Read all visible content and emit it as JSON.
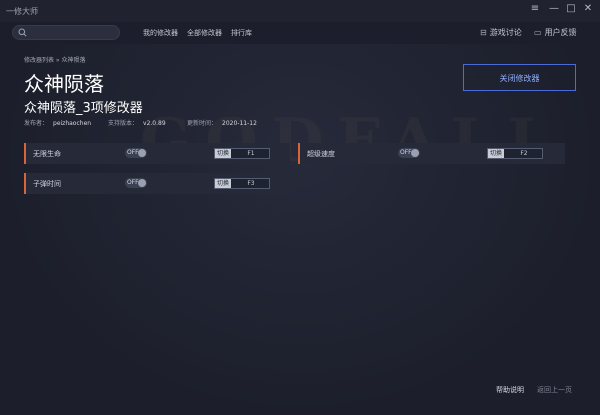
{
  "window": {
    "title": "一修大师",
    "controls": [
      "≡",
      "—",
      "□",
      "✕"
    ]
  },
  "header": {
    "search": {
      "placeholder": "",
      "value": ""
    },
    "nav": [
      "我的修改器",
      "全部修改器",
      "排行库"
    ],
    "right": [
      {
        "icon": "chat-icon",
        "label": "游戏讨论"
      },
      {
        "icon": "feedback-icon",
        "label": "用户反馈"
      }
    ]
  },
  "page": {
    "breadcrumb": "修改器列表 » 众神陨落",
    "game_title": "众神陨落",
    "trainer_title": "众神陨落_3项修改器",
    "meta": [
      {
        "label": "发布者：",
        "value": "peizhaochen"
      },
      {
        "label": "支持版本：",
        "value": "v2.0.89"
      },
      {
        "label": "更新时间：",
        "value": "2020-11-12"
      }
    ],
    "close_button": "关闭修改器"
  },
  "cheats": [
    {
      "name": "无限生命",
      "state": "OFF",
      "modifier": "切换",
      "key": "F1"
    },
    {
      "name": "超级速度",
      "state": "OFF",
      "modifier": "切换",
      "key": "F2"
    },
    {
      "name": "子弹时间",
      "state": "OFF",
      "modifier": "切换",
      "key": "F3"
    }
  ],
  "footer": {
    "help": "帮助说明",
    "back": "返回上一页"
  },
  "watermark": "GODFALL",
  "colors": {
    "background": "#1c1f2b",
    "accent_blue": "#4c6bd6",
    "accent_orange": "#d8643a"
  }
}
